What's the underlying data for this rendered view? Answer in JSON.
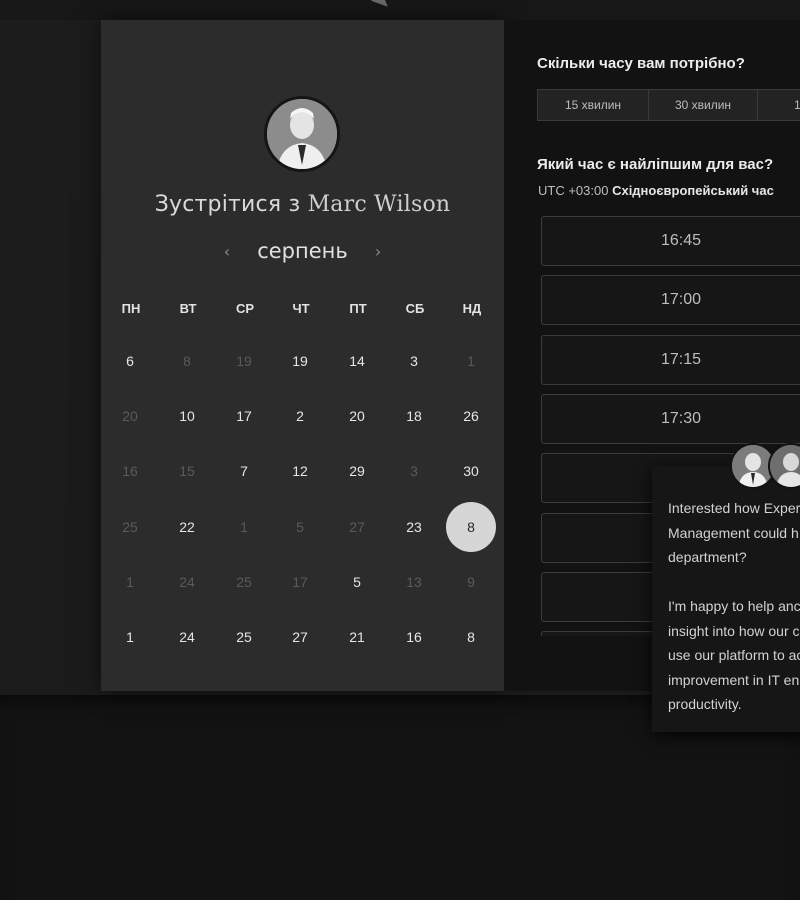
{
  "scheduler": {
    "host": {
      "meet_prefix": "Зустрітися з",
      "name": "Marc Wilson"
    },
    "calendar": {
      "prev_icon": "chevron-left",
      "next_icon": "chevron-right",
      "month": "серпень",
      "weekdays": [
        "ПН",
        "ВТ",
        "СР",
        "ЧТ",
        "ПТ",
        "СБ",
        "НД"
      ],
      "weeks": [
        [
          {
            "d": "6",
            "on": true
          },
          {
            "d": "8",
            "on": false
          },
          {
            "d": "19",
            "on": false
          },
          {
            "d": "19",
            "on": true
          },
          {
            "d": "14",
            "on": true
          },
          {
            "d": "3",
            "on": true
          },
          {
            "d": "1",
            "on": false
          }
        ],
        [
          {
            "d": "20",
            "on": false
          },
          {
            "d": "10",
            "on": true
          },
          {
            "d": "17",
            "on": true
          },
          {
            "d": "2",
            "on": true
          },
          {
            "d": "20",
            "on": true
          },
          {
            "d": "18",
            "on": true
          },
          {
            "d": "26",
            "on": true
          }
        ],
        [
          {
            "d": "16",
            "on": false
          },
          {
            "d": "15",
            "on": false
          },
          {
            "d": "7",
            "on": true
          },
          {
            "d": "12",
            "on": true
          },
          {
            "d": "29",
            "on": true
          },
          {
            "d": "3",
            "on": false
          },
          {
            "d": "30",
            "on": true
          }
        ],
        [
          {
            "d": "25",
            "on": false
          },
          {
            "d": "22",
            "on": true
          },
          {
            "d": "1",
            "on": false
          },
          {
            "d": "5",
            "on": false
          },
          {
            "d": "27",
            "on": false
          },
          {
            "d": "23",
            "on": true
          },
          {
            "d": "8",
            "on": true,
            "selected": true
          }
        ],
        [
          {
            "d": "1",
            "on": false
          },
          {
            "d": "24",
            "on": false
          },
          {
            "d": "25",
            "on": false
          },
          {
            "d": "17",
            "on": false
          },
          {
            "d": "5",
            "on": true
          },
          {
            "d": "13",
            "on": false
          },
          {
            "d": "9",
            "on": false
          }
        ],
        [
          {
            "d": "1",
            "on": true
          },
          {
            "d": "24",
            "on": true
          },
          {
            "d": "25",
            "on": true
          },
          {
            "d": "27",
            "on": true
          },
          {
            "d": "21",
            "on": true
          },
          {
            "d": "16",
            "on": true
          },
          {
            "d": "8",
            "on": true
          }
        ]
      ]
    },
    "duration": {
      "question": "Скільки часу вам потрібно?",
      "options": [
        "15 хвилин",
        "30 хвилин",
        "1"
      ]
    },
    "time": {
      "question": "Який час є найліпшим для вас?",
      "tz_offset": "UTC +03:00",
      "tz_name": "Східноєвропейський час",
      "slots": [
        "16:45",
        "17:00",
        "17:15",
        "17:30",
        "",
        "",
        "",
        ""
      ]
    },
    "chat": {
      "message": "Interested how Exper\nManagement could h\ndepartment?\n\nI'm happy to help anc\ninsight into how our c\nuse our platform to ac\nimprovement in IT en\nproductivity."
    }
  }
}
